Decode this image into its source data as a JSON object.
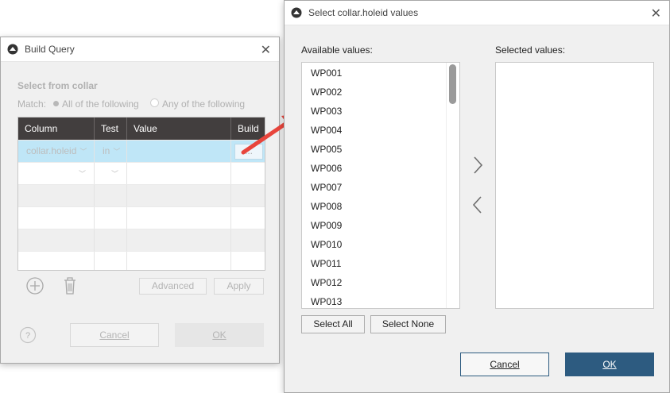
{
  "colors": {
    "accent": "#2d5b80",
    "header_dark": "#423e3e",
    "selection": "#bfe6f7",
    "callout": "#e8453c"
  },
  "build_query": {
    "title": "Build Query",
    "select_from": "Select from collar",
    "match_label": "Match:",
    "match_all": "All of the following",
    "match_any": "Any of the following",
    "columns": [
      "Column",
      "Test",
      "Value",
      "Build"
    ],
    "rows": [
      {
        "column": "collar.holeid",
        "test": "in",
        "value": "",
        "build": "..."
      }
    ],
    "advanced_label": "Advanced",
    "apply_label": "Apply",
    "cancel_label": "Cancel",
    "ok_label": "OK",
    "help_label": "?",
    "icons": {
      "app": "leapfrog-icon",
      "close": "close-icon",
      "add": "add-circle-icon",
      "delete": "trash-icon",
      "help": "help-icon"
    }
  },
  "select_values": {
    "title": "Select collar.holeid values",
    "available_label": "Available values:",
    "selected_label": "Selected values:",
    "available": [
      "WP001",
      "WP002",
      "WP003",
      "WP004",
      "WP005",
      "WP006",
      "WP007",
      "WP008",
      "WP009",
      "WP010",
      "WP011",
      "WP012",
      "WP013"
    ],
    "selected": [],
    "select_all_label": "Select All",
    "select_none_label": "Select None",
    "cancel_label": "Cancel",
    "ok_label": "OK",
    "icons": {
      "move_right": "chevron-right-icon",
      "move_left": "chevron-left-icon"
    }
  }
}
